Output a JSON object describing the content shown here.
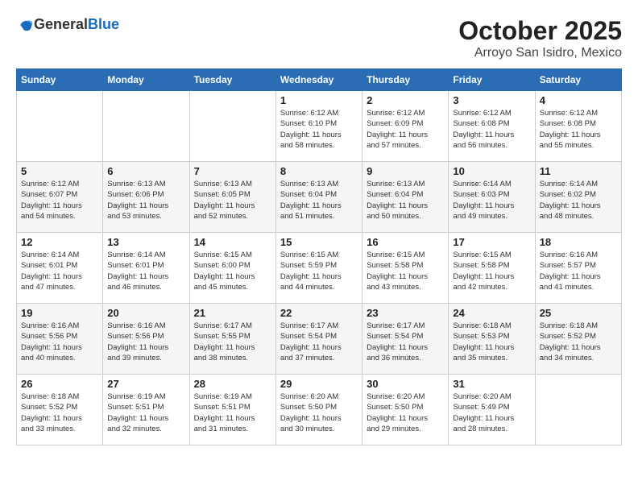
{
  "logo": {
    "text_general": "General",
    "text_blue": "Blue"
  },
  "header": {
    "month": "October 2025",
    "location": "Arroyo San Isidro, Mexico"
  },
  "weekdays": [
    "Sunday",
    "Monday",
    "Tuesday",
    "Wednesday",
    "Thursday",
    "Friday",
    "Saturday"
  ],
  "weeks": [
    [
      {
        "day": "",
        "info": ""
      },
      {
        "day": "",
        "info": ""
      },
      {
        "day": "",
        "info": ""
      },
      {
        "day": "1",
        "info": "Sunrise: 6:12 AM\nSunset: 6:10 PM\nDaylight: 11 hours\nand 58 minutes."
      },
      {
        "day": "2",
        "info": "Sunrise: 6:12 AM\nSunset: 6:09 PM\nDaylight: 11 hours\nand 57 minutes."
      },
      {
        "day": "3",
        "info": "Sunrise: 6:12 AM\nSunset: 6:08 PM\nDaylight: 11 hours\nand 56 minutes."
      },
      {
        "day": "4",
        "info": "Sunrise: 6:12 AM\nSunset: 6:08 PM\nDaylight: 11 hours\nand 55 minutes."
      }
    ],
    [
      {
        "day": "5",
        "info": "Sunrise: 6:12 AM\nSunset: 6:07 PM\nDaylight: 11 hours\nand 54 minutes."
      },
      {
        "day": "6",
        "info": "Sunrise: 6:13 AM\nSunset: 6:06 PM\nDaylight: 11 hours\nand 53 minutes."
      },
      {
        "day": "7",
        "info": "Sunrise: 6:13 AM\nSunset: 6:05 PM\nDaylight: 11 hours\nand 52 minutes."
      },
      {
        "day": "8",
        "info": "Sunrise: 6:13 AM\nSunset: 6:04 PM\nDaylight: 11 hours\nand 51 minutes."
      },
      {
        "day": "9",
        "info": "Sunrise: 6:13 AM\nSunset: 6:04 PM\nDaylight: 11 hours\nand 50 minutes."
      },
      {
        "day": "10",
        "info": "Sunrise: 6:14 AM\nSunset: 6:03 PM\nDaylight: 11 hours\nand 49 minutes."
      },
      {
        "day": "11",
        "info": "Sunrise: 6:14 AM\nSunset: 6:02 PM\nDaylight: 11 hours\nand 48 minutes."
      }
    ],
    [
      {
        "day": "12",
        "info": "Sunrise: 6:14 AM\nSunset: 6:01 PM\nDaylight: 11 hours\nand 47 minutes."
      },
      {
        "day": "13",
        "info": "Sunrise: 6:14 AM\nSunset: 6:01 PM\nDaylight: 11 hours\nand 46 minutes."
      },
      {
        "day": "14",
        "info": "Sunrise: 6:15 AM\nSunset: 6:00 PM\nDaylight: 11 hours\nand 45 minutes."
      },
      {
        "day": "15",
        "info": "Sunrise: 6:15 AM\nSunset: 5:59 PM\nDaylight: 11 hours\nand 44 minutes."
      },
      {
        "day": "16",
        "info": "Sunrise: 6:15 AM\nSunset: 5:58 PM\nDaylight: 11 hours\nand 43 minutes."
      },
      {
        "day": "17",
        "info": "Sunrise: 6:15 AM\nSunset: 5:58 PM\nDaylight: 11 hours\nand 42 minutes."
      },
      {
        "day": "18",
        "info": "Sunrise: 6:16 AM\nSunset: 5:57 PM\nDaylight: 11 hours\nand 41 minutes."
      }
    ],
    [
      {
        "day": "19",
        "info": "Sunrise: 6:16 AM\nSunset: 5:56 PM\nDaylight: 11 hours\nand 40 minutes."
      },
      {
        "day": "20",
        "info": "Sunrise: 6:16 AM\nSunset: 5:56 PM\nDaylight: 11 hours\nand 39 minutes."
      },
      {
        "day": "21",
        "info": "Sunrise: 6:17 AM\nSunset: 5:55 PM\nDaylight: 11 hours\nand 38 minutes."
      },
      {
        "day": "22",
        "info": "Sunrise: 6:17 AM\nSunset: 5:54 PM\nDaylight: 11 hours\nand 37 minutes."
      },
      {
        "day": "23",
        "info": "Sunrise: 6:17 AM\nSunset: 5:54 PM\nDaylight: 11 hours\nand 36 minutes."
      },
      {
        "day": "24",
        "info": "Sunrise: 6:18 AM\nSunset: 5:53 PM\nDaylight: 11 hours\nand 35 minutes."
      },
      {
        "day": "25",
        "info": "Sunrise: 6:18 AM\nSunset: 5:52 PM\nDaylight: 11 hours\nand 34 minutes."
      }
    ],
    [
      {
        "day": "26",
        "info": "Sunrise: 6:18 AM\nSunset: 5:52 PM\nDaylight: 11 hours\nand 33 minutes."
      },
      {
        "day": "27",
        "info": "Sunrise: 6:19 AM\nSunset: 5:51 PM\nDaylight: 11 hours\nand 32 minutes."
      },
      {
        "day": "28",
        "info": "Sunrise: 6:19 AM\nSunset: 5:51 PM\nDaylight: 11 hours\nand 31 minutes."
      },
      {
        "day": "29",
        "info": "Sunrise: 6:20 AM\nSunset: 5:50 PM\nDaylight: 11 hours\nand 30 minutes."
      },
      {
        "day": "30",
        "info": "Sunrise: 6:20 AM\nSunset: 5:50 PM\nDaylight: 11 hours\nand 29 minutes."
      },
      {
        "day": "31",
        "info": "Sunrise: 6:20 AM\nSunset: 5:49 PM\nDaylight: 11 hours\nand 28 minutes."
      },
      {
        "day": "",
        "info": ""
      }
    ]
  ]
}
